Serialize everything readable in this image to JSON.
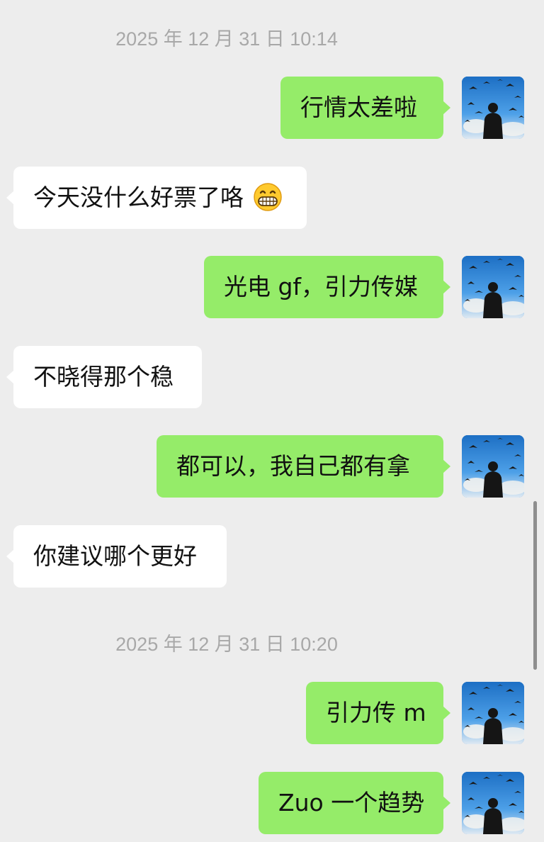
{
  "timestamps": {
    "t1": "2025 年 12 月 31 日 10:14",
    "t2": "2025 年 12 月 31 日 10:20"
  },
  "messages": [
    {
      "side": "sent",
      "text": "行情太差啦"
    },
    {
      "side": "received",
      "text": "今天没什么好票了咯",
      "emoji": "grinning-face-icon"
    },
    {
      "side": "sent",
      "text": "光电 gf，引力传媒"
    },
    {
      "side": "received",
      "text": "不晓得那个稳"
    },
    {
      "side": "sent",
      "text": "都可以，我自己都有拿"
    },
    {
      "side": "received",
      "text": "你建议哪个更好"
    },
    {
      "side": "sent",
      "text": "引力传 m"
    },
    {
      "side": "sent",
      "text": "Zuo 一个趋势"
    }
  ],
  "colors": {
    "background": "#ededed",
    "sent_bubble": "#95ec69",
    "received_bubble": "#ffffff",
    "timestamp_text": "#a8a8a8"
  }
}
